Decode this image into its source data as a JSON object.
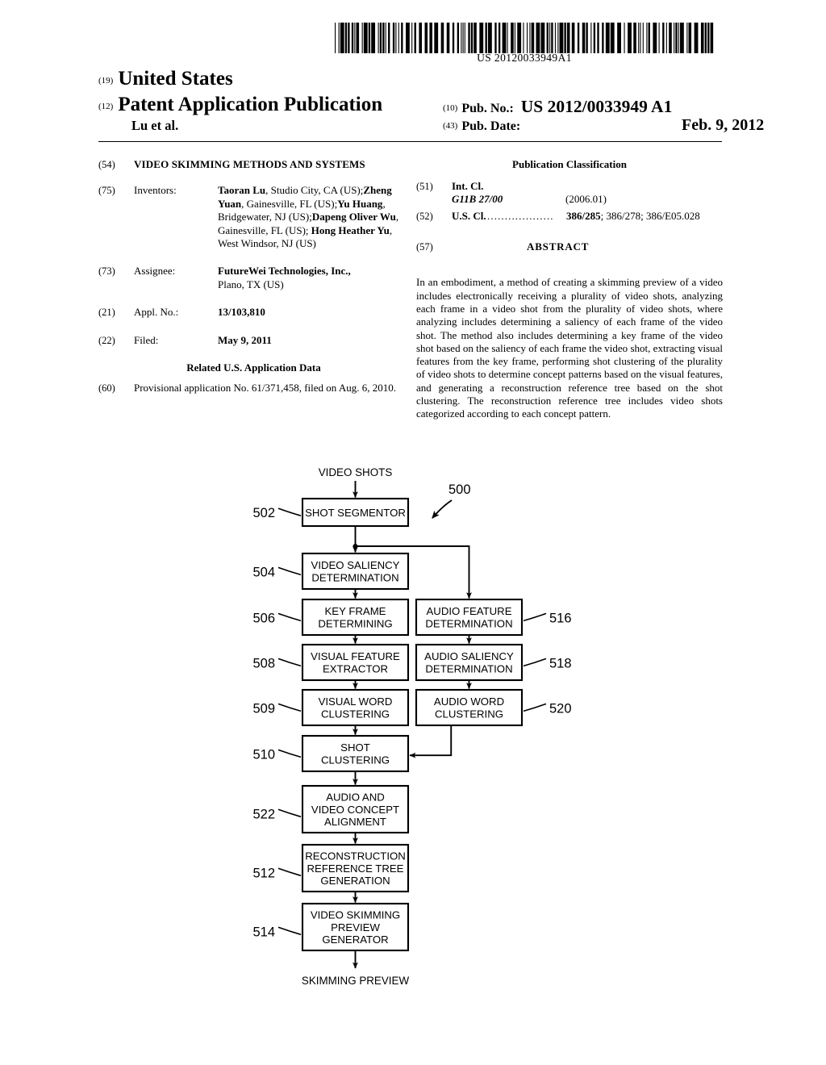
{
  "barcode": {
    "number": "US 20120033949A1"
  },
  "header": {
    "country_tag": "(19)",
    "country": "United States",
    "doctype_tag": "(12)",
    "doctype": "Patent Application Publication",
    "authors": "Lu et al.",
    "pubno_tag": "(10)",
    "pubno_label": "Pub. No.:",
    "pubno_value": "US 2012/0033949 A1",
    "pubdate_tag": "(43)",
    "pubdate_label": "Pub. Date:",
    "pubdate_value": "Feb. 9, 2012"
  },
  "left_column": {
    "title_tag": "(54)",
    "title": "VIDEO SKIMMING METHODS AND SYSTEMS",
    "inventors_tag": "(75)",
    "inventors_label": "Inventors:",
    "inventors": [
      {
        "name": "Taoran Lu",
        "location": ", Studio City, CA (US);"
      },
      {
        "name": "Zheng Yuan",
        "location": ", Gainesville, FL (US);"
      },
      {
        "name": "Yu Huang",
        "location": ", Bridgewater, NJ (US);"
      },
      {
        "name": "Dapeng Oliver Wu",
        "location": ", Gainesville, FL (US); "
      },
      {
        "name": "Hong Heather Yu",
        "location": ", West Windsor, NJ (US)"
      }
    ],
    "assignee_tag": "(73)",
    "assignee_label": "Assignee:",
    "assignee_name": "FutureWei Technologies, Inc.,",
    "assignee_location": "Plano, TX (US)",
    "applno_tag": "(21)",
    "applno_label": "Appl. No.:",
    "applno_value": "13/103,810",
    "filed_tag": "(22)",
    "filed_label": "Filed:",
    "filed_value": "May 9, 2011",
    "related_heading": "Related U.S. Application Data",
    "related_tag": "(60)",
    "related_text": "Provisional application No. 61/371,458, filed on Aug. 6, 2010."
  },
  "right_column": {
    "pubclass_heading": "Publication Classification",
    "intcl_tag": "(51)",
    "intcl_label": "Int. Cl.",
    "intcl_code": "G11B 27/00",
    "intcl_version": "(2006.01)",
    "uscl_tag": "(52)",
    "uscl_label": "U.S. Cl.",
    "uscl_dots": "...................",
    "uscl_primary": "386/285",
    "uscl_rest": "; 386/278; 386/E05.028",
    "abstract_tag": "(57)",
    "abstract_heading": "ABSTRACT",
    "abstract_text": "In an embodiment, a method of creating a skimming preview of a video includes electronically receiving a plurality of video shots, analyzing each frame in a video shot from the plurality of video shots, where analyzing includes determining a saliency of each frame of the video shot. The method also includes determining a key frame of the video shot based on the saliency of each frame the video shot, extracting visual features from the key frame, performing shot clustering of the plurality of video shots to determine concept patterns based on the visual features, and generating a reconstruction reference tree based on the shot clustering. The reconstruction reference tree includes video shots categorized according to each concept pattern."
  },
  "figure": {
    "figure_ref": "500",
    "input_label": "VIDEO SHOTS",
    "output_label": "SKIMMING PREVIEW",
    "boxes": [
      {
        "ref": "502",
        "lines": [
          "SHOT SEGMENTOR"
        ],
        "column": "left"
      },
      {
        "ref": "504",
        "lines": [
          "VIDEO SALIENCY",
          "DETERMINATION"
        ],
        "column": "left"
      },
      {
        "ref": "506",
        "lines": [
          "KEY FRAME",
          "DETERMINING"
        ],
        "column": "left"
      },
      {
        "ref": "508",
        "lines": [
          "VISUAL FEATURE",
          "EXTRACTOR"
        ],
        "column": "left"
      },
      {
        "ref": "509",
        "lines": [
          "VISUAL WORD",
          "CLUSTERING"
        ],
        "column": "left"
      },
      {
        "ref": "510",
        "lines": [
          "SHOT",
          "CLUSTERING"
        ],
        "column": "left"
      },
      {
        "ref": "522",
        "lines": [
          "AUDIO AND",
          "VIDEO CONCEPT",
          "ALIGNMENT"
        ],
        "column": "left"
      },
      {
        "ref": "512",
        "lines": [
          "RECONSTRUCTION",
          "REFERENCE TREE",
          "GENERATION"
        ],
        "column": "left"
      },
      {
        "ref": "514",
        "lines": [
          "VIDEO SKIMMING",
          "PREVIEW",
          "GENERATOR"
        ],
        "column": "left"
      },
      {
        "ref": "516",
        "lines": [
          "AUDIO FEATURE",
          "DETERMINATION"
        ],
        "column": "right"
      },
      {
        "ref": "518",
        "lines": [
          "AUDIO SALIENCY",
          "DETERMINATION"
        ],
        "column": "right"
      },
      {
        "ref": "520",
        "lines": [
          "AUDIO WORD",
          "CLUSTERING"
        ],
        "column": "right"
      }
    ]
  }
}
